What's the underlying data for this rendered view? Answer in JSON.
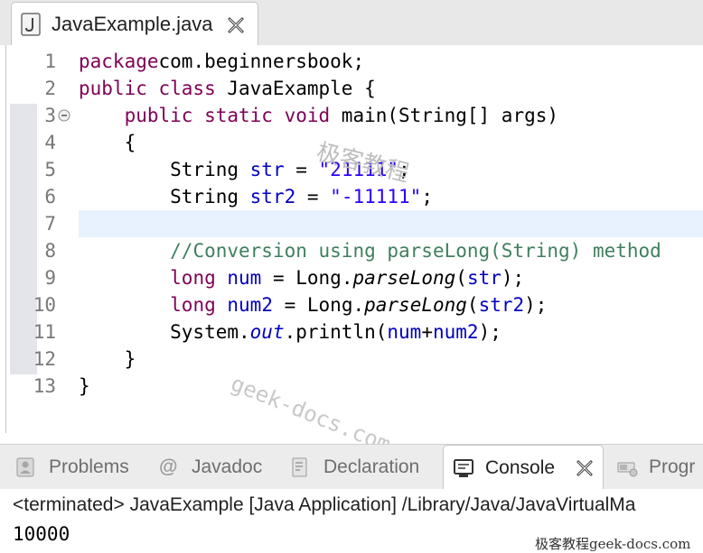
{
  "editor": {
    "tab_label": "JavaExample.java"
  },
  "code_lines": [
    {
      "n": "1",
      "segments": [
        [
          "kw",
          "package"
        ],
        [
          "",
          "com.beginnersbook;"
        ]
      ]
    },
    {
      "n": "2",
      "segments": [
        [
          "kw",
          "public class"
        ],
        [
          "",
          " JavaExample {"
        ]
      ]
    },
    {
      "n": "3",
      "segments": [
        [
          "",
          "    "
        ],
        [
          "kw",
          "public static void"
        ],
        [
          "",
          " main(String[] args)"
        ]
      ]
    },
    {
      "n": "4",
      "segments": [
        [
          "",
          "    {"
        ]
      ]
    },
    {
      "n": "5",
      "segments": [
        [
          "",
          "        String "
        ],
        [
          "fld",
          "str"
        ],
        [
          "",
          " = "
        ],
        [
          "str",
          "\"21111\""
        ],
        [
          "",
          ";"
        ]
      ]
    },
    {
      "n": "6",
      "segments": [
        [
          "",
          "        String "
        ],
        [
          "fld",
          "str2"
        ],
        [
          "",
          " = "
        ],
        [
          "str",
          "\"-11111\""
        ],
        [
          "",
          ";"
        ]
      ]
    },
    {
      "n": "7",
      "segments": []
    },
    {
      "n": "8",
      "segments": [
        [
          "",
          "        "
        ],
        [
          "cmt",
          "//Conversion using parseLong(String) method"
        ]
      ]
    },
    {
      "n": "9",
      "segments": [
        [
          "",
          "        "
        ],
        [
          "kw",
          "long"
        ],
        [
          "",
          " "
        ],
        [
          "fld",
          "num"
        ],
        [
          "",
          " = Long."
        ],
        [
          "ita",
          "parseLong"
        ],
        [
          "",
          "("
        ],
        [
          "fld",
          "str"
        ],
        [
          "",
          ");"
        ]
      ]
    },
    {
      "n": "10",
      "segments": [
        [
          "",
          "        "
        ],
        [
          "kw",
          "long"
        ],
        [
          "",
          " "
        ],
        [
          "fld",
          "num2"
        ],
        [
          "",
          " = Long."
        ],
        [
          "ita",
          "parseLong"
        ],
        [
          "",
          "("
        ],
        [
          "fld",
          "str2"
        ],
        [
          "",
          ");"
        ]
      ]
    },
    {
      "n": "11",
      "segments": [
        [
          "",
          "        System."
        ],
        [
          "fldi",
          "out"
        ],
        [
          "",
          ".println("
        ],
        [
          "fld",
          "num"
        ],
        [
          "",
          "+"
        ],
        [
          "fld",
          "num2"
        ],
        [
          "",
          ");"
        ]
      ]
    },
    {
      "n": "12",
      "segments": [
        [
          "",
          "    }"
        ]
      ]
    },
    {
      "n": "13",
      "segments": [
        [
          "",
          "}"
        ]
      ]
    }
  ],
  "views": {
    "problems": "Problems",
    "javadoc": "Javadoc",
    "declaration": "Declaration",
    "console": "Console",
    "progress": "Progr"
  },
  "console": {
    "status": "<terminated> JavaExample [Java Application] /Library/Java/JavaVirtualMa",
    "output": "10000"
  },
  "watermarks": {
    "cn": "极客教程",
    "url": "geek-docs.com",
    "site_mark": "极客教程geek-docs.com"
  },
  "colors": {
    "keyword": "#7f0055",
    "string": "#2a00ff",
    "field": "#0000c0",
    "comment": "#3f7f5f",
    "current_line": "#e8f2fe"
  },
  "icons": {
    "file": "java-file-icon",
    "close": "close-icon",
    "fold": "fold-collapse-icon",
    "problems": "problems-icon",
    "javadoc": "javadoc-icon",
    "declaration": "declaration-icon",
    "console": "console-icon",
    "progress": "progress-icon"
  }
}
